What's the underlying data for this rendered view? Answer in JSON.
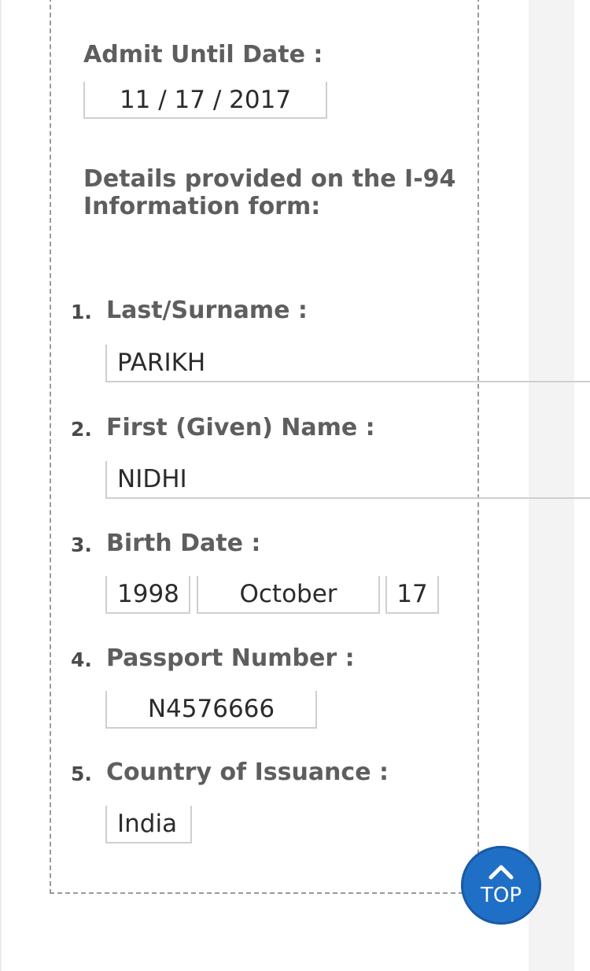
{
  "admit_until": {
    "label": "Admit Until Date :",
    "value": "11 / 17 / 2017"
  },
  "section_heading": {
    "line1": "Details provided on the I-94",
    "line2": "Information form:"
  },
  "fields": [
    {
      "num": "1.",
      "label": "Last/Surname :",
      "values": [
        "PARIKH"
      ]
    },
    {
      "num": "2.",
      "label": "First (Given) Name :",
      "values": [
        "NIDHI"
      ]
    },
    {
      "num": "3.",
      "label": "Birth Date :",
      "values": [
        "1998",
        "October",
        "17"
      ]
    },
    {
      "num": "4.",
      "label": "Passport Number :",
      "values": [
        "N4576666"
      ]
    },
    {
      "num": "5.",
      "label": "Country of Issuance :",
      "values": [
        "India"
      ]
    }
  ],
  "top_button": {
    "label": "TOP",
    "icon": "chevron-up-icon",
    "color": "#1f6fc6"
  }
}
